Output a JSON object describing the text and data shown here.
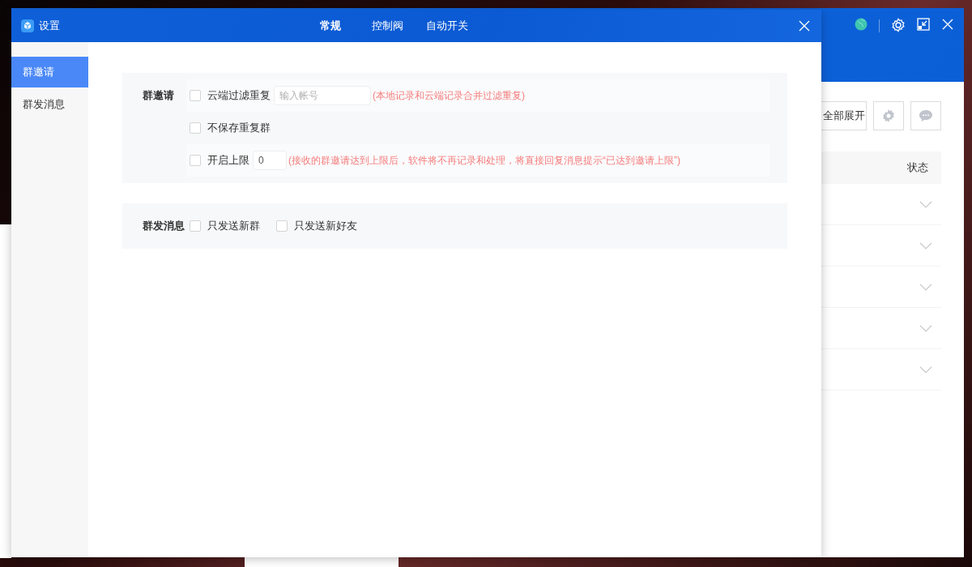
{
  "background_window": {
    "toolbar": {
      "expand_all_button": "全部展开"
    },
    "table": {
      "columns": [
        "状态"
      ],
      "rows": [
        {
          "expanded": false
        },
        {
          "expanded": false
        },
        {
          "expanded": false
        },
        {
          "expanded": false
        },
        {
          "expanded": false
        }
      ]
    }
  },
  "dialog": {
    "title": "设置",
    "tabs": [
      {
        "label": "常规",
        "selected": true
      },
      {
        "label": "控制阀",
        "selected": false
      },
      {
        "label": "自动开关",
        "selected": false
      }
    ],
    "sidebar": {
      "items": [
        {
          "label": "群邀请",
          "selected": true
        },
        {
          "label": "群发消息",
          "selected": false
        }
      ]
    },
    "sections": [
      {
        "label": "群邀请",
        "rows": [
          {
            "options": [
              {
                "label": "云端过滤重复",
                "checked": false
              }
            ],
            "input": {
              "placeholder": "输入帐号"
            },
            "hint": "(本地记录和云端记录合并过滤重复)"
          },
          {
            "options": [
              {
                "label": "不保存重复群",
                "checked": false
              }
            ]
          },
          {
            "options": [
              {
                "label": "开启上限",
                "checked": false
              }
            ],
            "input": {
              "value": "0"
            },
            "hint": "(接收的群邀请达到上限后，软件将不再记录和处理，将直接回复消息提示“已达到邀请上限”)"
          }
        ]
      },
      {
        "label": "群发消息",
        "rows": [
          {
            "options": [
              {
                "label": "只发送新群",
                "checked": false
              },
              {
                "label": "只发送新好友",
                "checked": false
              }
            ]
          }
        ]
      }
    ]
  }
}
